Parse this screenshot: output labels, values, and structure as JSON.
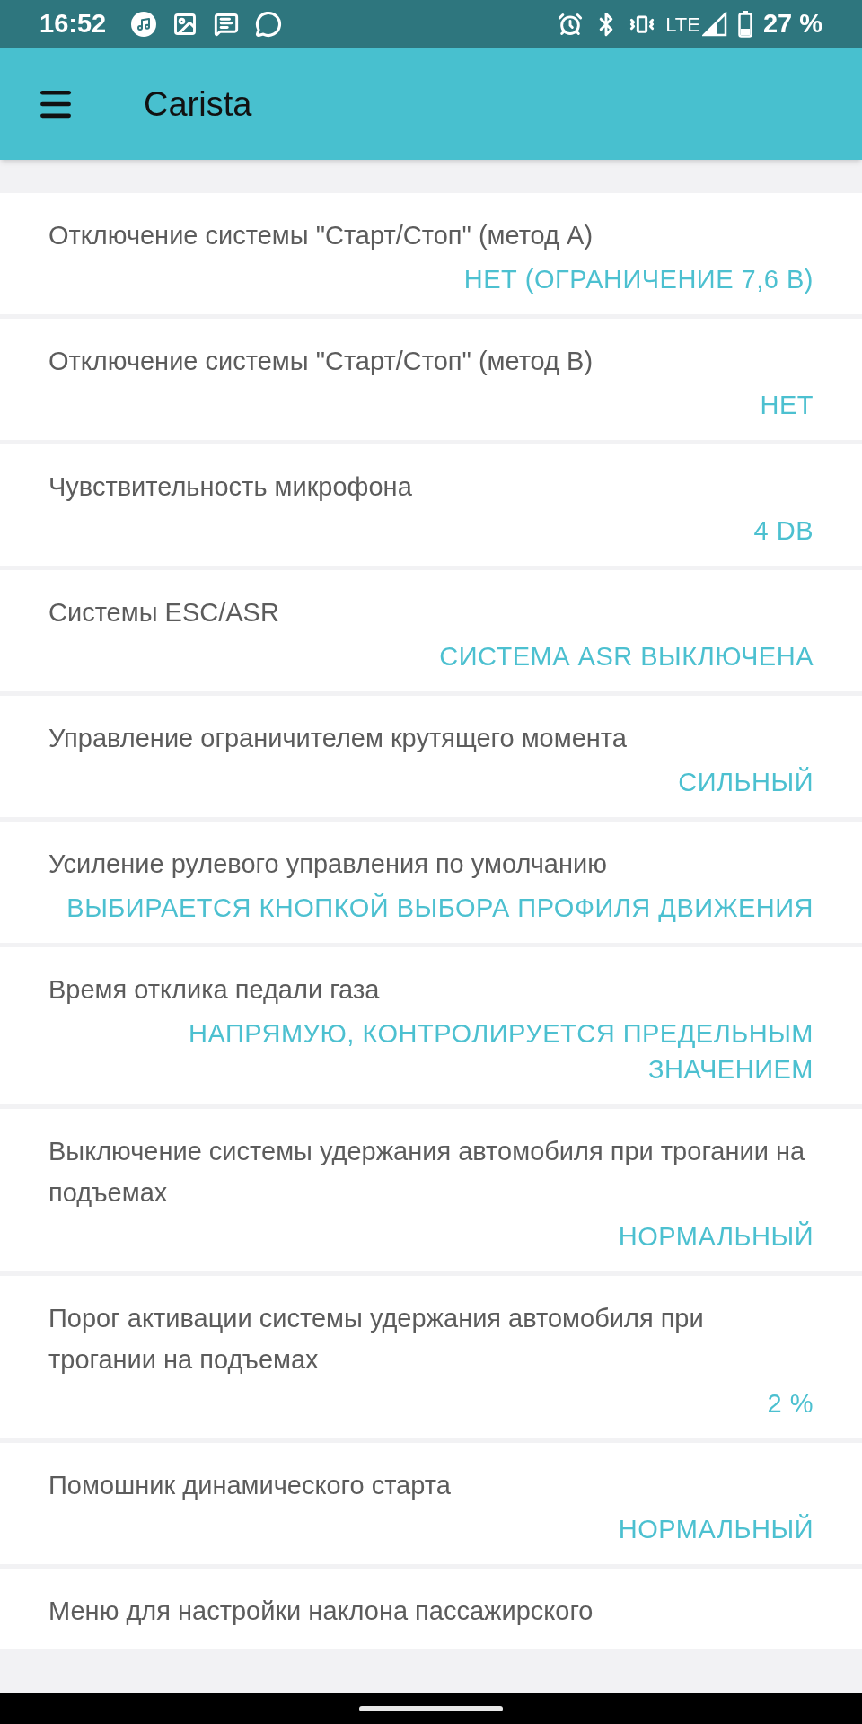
{
  "status_bar": {
    "time": "16:52",
    "network": "LTE",
    "battery": "27 %"
  },
  "app_bar": {
    "title": "Carista"
  },
  "settings": [
    {
      "title": "Отключение системы \"Старт/Стоп\" (метод А)",
      "value": "НЕТ (ОГРАНИЧЕНИЕ 7,6 В)"
    },
    {
      "title": "Отключение системы \"Старт/Стоп\" (метод В)",
      "value": "НЕТ"
    },
    {
      "title": "Чувствительность микрофона",
      "value": "4 DB"
    },
    {
      "title": "Системы ESC/ASR",
      "value": "СИСТЕМА ASR ВЫКЛЮЧЕНА"
    },
    {
      "title": "Управление ограничителем крутящего момента",
      "value": "СИЛЬНЫЙ"
    },
    {
      "title": "Усиление рулевого управления по умолчанию",
      "value": "ВЫБИРАЕТСЯ КНОПКОЙ ВЫБОРА ПРОФИЛЯ ДВИЖЕНИЯ"
    },
    {
      "title": "Время отклика педали газа",
      "value": "НАПРЯМУЮ, КОНТРОЛИРУЕТСЯ ПРЕДЕЛЬНЫМ ЗНАЧЕНИЕМ"
    },
    {
      "title": "Выключение системы удержания автомобиля при трогании на подъемах",
      "value": "НОРМАЛЬНЫЙ"
    },
    {
      "title": "Порог активации системы удержания автомобиля при трогании на подъемах",
      "value": "2 %"
    },
    {
      "title": "Помошник динамического старта",
      "value": "НОРМАЛЬНЫЙ"
    },
    {
      "title": "Меню для настройки наклона пассажирского"
    }
  ]
}
